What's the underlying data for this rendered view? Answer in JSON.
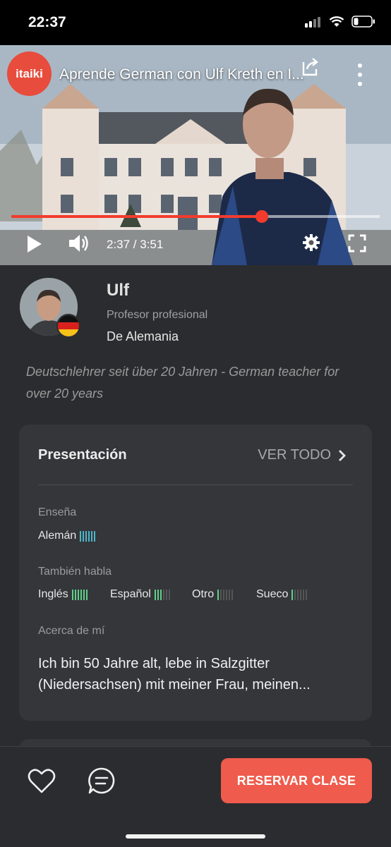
{
  "status_bar": {
    "time": "22:37"
  },
  "video": {
    "channel_logo": "itaiki",
    "title": "Aprende German con Ulf Kreth en I...",
    "current_time": "2:37",
    "duration": "3:51",
    "time_display": "2:37 / 3:51",
    "progress": 0.68,
    "icons": [
      "share-icon",
      "more-options-icon",
      "play-icon",
      "volume-icon",
      "settings-icon",
      "fullscreen-icon"
    ]
  },
  "teacher": {
    "name": "Ulf",
    "role": "Profesor profesional",
    "origin": "De Alemania",
    "tagline": "Deutschlehrer seit über 20 Jahren - German teacher for over 20 years"
  },
  "presentation": {
    "title": "Presentación",
    "view_all": "VER TODO",
    "teaches_label": "Enseña",
    "teaches": [
      {
        "name": "Alemán",
        "level": 6,
        "color": "#4fb6c9"
      }
    ],
    "also_speaks_label": "También habla",
    "also_speaks": [
      {
        "name": "Inglés",
        "level": 6,
        "color": "#5fcf8a"
      },
      {
        "name": "Español",
        "level": 3,
        "color": "#5fcf8a"
      },
      {
        "name": "Otro",
        "level": 1,
        "color": "#5fcf8a"
      },
      {
        "name": "Sueco",
        "level": 1,
        "color": "#5fcf8a"
      }
    ],
    "about_label": "Acerca de mí",
    "about_text": "Ich bin 50 Jahre alt, lebe in Salzgitter (Niedersachsen) mit meiner Frau, meinen..."
  },
  "bottom_bar": {
    "book_button": "RESERVAR CLASE"
  },
  "colors": {
    "accent": "#ef5b4c",
    "progress": "#f23b2d",
    "background": "#2b2c2f",
    "card": "#34363a"
  }
}
